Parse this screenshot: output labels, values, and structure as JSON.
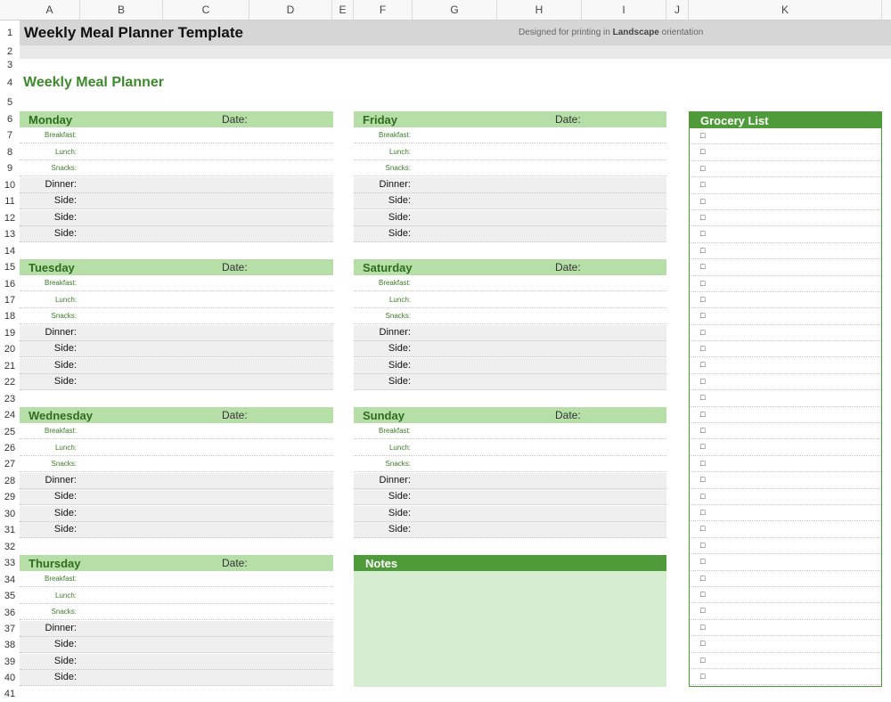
{
  "columns": [
    "A",
    "B",
    "C",
    "D",
    "E",
    "F",
    "G",
    "H",
    "I",
    "J",
    "K"
  ],
  "rows": [
    "1",
    "2",
    "3",
    "4",
    "5",
    "6",
    "7",
    "8",
    "9",
    "10",
    "11",
    "12",
    "13",
    "14",
    "15",
    "16",
    "17",
    "18",
    "19",
    "20",
    "21",
    "22",
    "23",
    "24",
    "25",
    "26",
    "27",
    "28",
    "29",
    "30",
    "31",
    "32",
    "33",
    "34",
    "35",
    "36",
    "37",
    "38",
    "39",
    "40",
    "41"
  ],
  "header": {
    "title": "Weekly Meal Planner Template",
    "subtitle_pre": "Designed for printing in ",
    "subtitle_bold": "Landscape",
    "subtitle_post": " orientation"
  },
  "planner_title": "Weekly Meal Planner",
  "date_label": "Date:",
  "meal_labels": [
    "Breakfast:",
    "Lunch:",
    "Snacks:",
    "Dinner:",
    "Side:",
    "Side:",
    "Side:"
  ],
  "days": [
    "Monday",
    "Tuesday",
    "Wednesday",
    "Thursday",
    "Friday",
    "Saturday",
    "Sunday"
  ],
  "notes_title": "Notes",
  "grocery": {
    "title": "Grocery List",
    "checkbox": "□",
    "count": 34
  }
}
